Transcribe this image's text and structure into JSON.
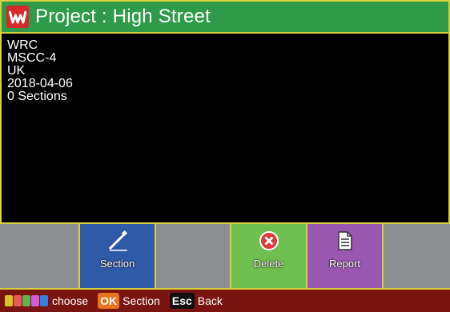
{
  "window": {
    "title": "Project : High Street",
    "logo_icon": "w-logo-icon"
  },
  "info": {
    "lines": [
      "WRC",
      "MSCC-4",
      "UK",
      "2018-04-06",
      "0 Sections"
    ]
  },
  "toolbar": {
    "section_label": "Section",
    "delete_label": "Delete",
    "report_label": "Report",
    "section_icon": "pencil-icon",
    "delete_icon": "close-circle-icon",
    "report_icon": "document-icon"
  },
  "statusbar": {
    "choose_label": "choose",
    "ok_key": "OK",
    "ok_label": "Section",
    "esc_key": "Esc",
    "esc_label": "Back",
    "color_keys": [
      "#d6c22b",
      "#ea5a5a",
      "#5fb34a",
      "#d25ad6",
      "#3a7de0"
    ]
  },
  "colors": {
    "title_bg": "#2f9a4a",
    "border": "#d7d23a",
    "section_bg": "#2e5aa8",
    "delete_bg": "#6ebf4f",
    "report_bg": "#9a57b2",
    "empty_bg": "#8c8f92",
    "status_bg": "#7a1410"
  }
}
